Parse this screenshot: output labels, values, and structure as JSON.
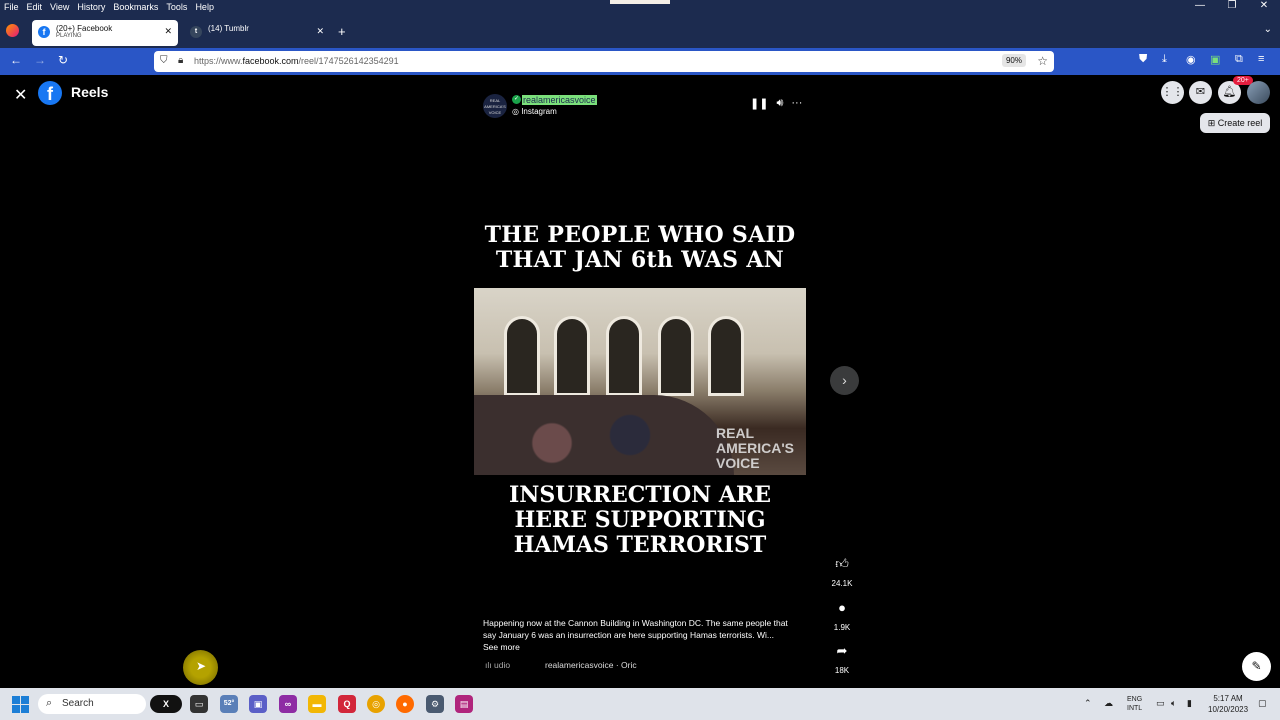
{
  "menubar": {
    "items": [
      "File",
      "Edit",
      "View",
      "History",
      "Bookmarks",
      "Tools",
      "Help"
    ],
    "window_controls": [
      "—",
      "❐",
      "✕"
    ]
  },
  "tabs": [
    {
      "title": "(20+) Facebook",
      "subtitle": "PLAYING",
      "favicon": "f"
    },
    {
      "title": "(14) Tumblr",
      "favicon": "t"
    }
  ],
  "navbar": {
    "url_prefix": "https://www.",
    "url_host": "facebook.com",
    "url_path": "/reel/1747526142354291",
    "zoom": "90%"
  },
  "page": {
    "section_title": "Reels",
    "notification_count": "20+",
    "create_reel_label": "Create reel",
    "reel": {
      "username": "realamericasvoice",
      "source": "Instagram",
      "avatar_text": "REAL AMERICA'S VOICE",
      "headline_top": "THE PEOPLE WHO SAID THAT JAN 6th WAS AN",
      "headline_bottom": "INSURRECTION ARE HERE SUPPORTING HAMAS TERRORIST",
      "watermark": "REAL AMERICA'S VOICE",
      "likes": "24.1K",
      "comments": "1.9K",
      "shares": "18K",
      "caption": "Happening now at the Cannon Building in Washington DC. The same people that say January 6 was an insurrection are here supporting Hamas terrorists. Wi...",
      "see_more": "See more",
      "audio_label": "udio",
      "audio_source": "realamericasvoice · Oric"
    }
  },
  "taskbar": {
    "search_placeholder": "Search",
    "weather_temp": "52°",
    "lang_top": "ENG",
    "lang_bottom": "INTL",
    "time": "5:17 AM",
    "date": "10/20/2023"
  },
  "colors": {
    "facebook_blue": "#1877f2",
    "browser_nav": "#2a56c6",
    "menubar_bg": "#1c2b4f",
    "highlight_green": "#7be07b"
  }
}
